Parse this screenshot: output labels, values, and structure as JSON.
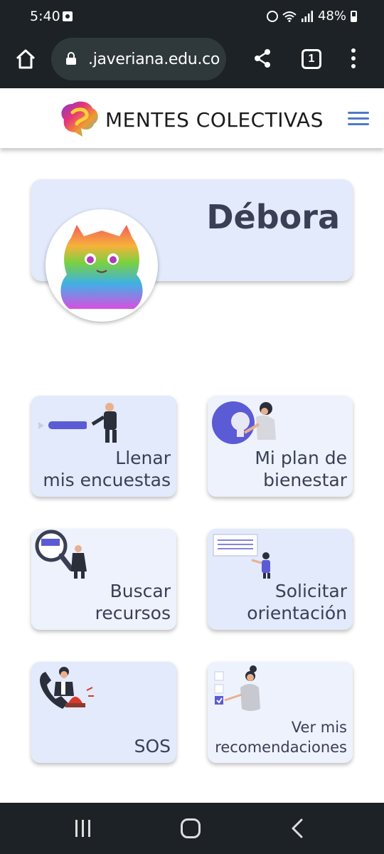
{
  "status_bar": {
    "time": "5:40",
    "battery": "48%"
  },
  "browser": {
    "url": ".javeriana.edu.co",
    "tab_count": "1"
  },
  "header": {
    "brand": "MENTES COLECTIVAS"
  },
  "profile": {
    "name": "Débora"
  },
  "tiles": [
    {
      "line1": "Llenar",
      "line2": "mis encuestas"
    },
    {
      "line1": "Mi plan de",
      "line2": "bienestar"
    },
    {
      "line1": "Buscar",
      "line2": "recursos"
    },
    {
      "line1": "Solicitar",
      "line2": "orientación"
    },
    {
      "line1": "",
      "line2": "SOS"
    },
    {
      "line1": "Ver mis",
      "line2": "recomendaciones"
    }
  ],
  "colors": {
    "accent_purple": "#5b5bd6",
    "card_blue": "#e2eafc",
    "text_dark": "#3a3f55",
    "system_bar": "#1c2225"
  }
}
